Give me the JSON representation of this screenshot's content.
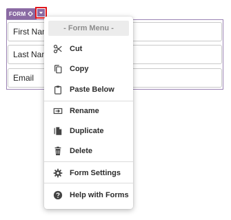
{
  "form": {
    "tag_label": "FORM",
    "fields": [
      {
        "label": "First Name"
      },
      {
        "label": "Last Name"
      },
      {
        "label": "Email"
      }
    ]
  },
  "menu": {
    "header": "- Form Menu -",
    "items": [
      {
        "label": "Cut",
        "icon": "scissors-icon"
      },
      {
        "label": "Copy",
        "icon": "copy-icon"
      },
      {
        "label": "Paste Below",
        "icon": "clipboard-icon"
      },
      {
        "label": "Rename",
        "icon": "rename-icon"
      },
      {
        "label": "Duplicate",
        "icon": "duplicate-icon"
      },
      {
        "label": "Delete",
        "icon": "trash-icon"
      },
      {
        "label": "Form Settings",
        "icon": "gear-icon"
      },
      {
        "label": "Help with Forms",
        "icon": "help-icon"
      }
    ]
  },
  "colors": {
    "form_accent": "#8a6aa3",
    "highlight_border": "#e0161c"
  }
}
